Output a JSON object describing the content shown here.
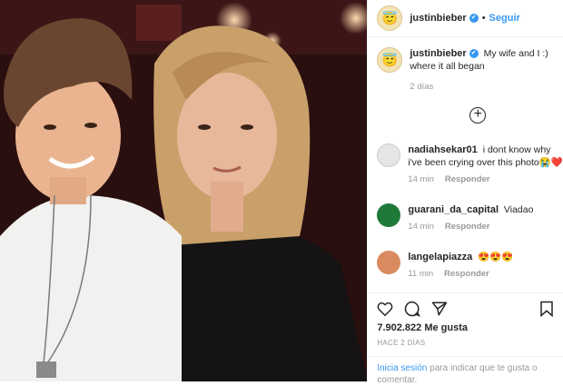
{
  "post": {
    "username": "justinbieber",
    "follow_label": "Seguir",
    "caption": "My wife and I :) where it all began",
    "caption_time": "2 días",
    "likes": "7.902.822 Me gusta",
    "posted_ago": "HACE 2 DÍAS",
    "login_link": "Inicia sesión",
    "login_rest": "para indicar que te gusta o comentar."
  },
  "comments": [
    {
      "user": "nadiahsekar01",
      "text": "i dont know why i've been crying over this photo😭❤️",
      "time": "14 min",
      "reply": "Responder"
    },
    {
      "user": "guarani_da_capital",
      "text": "Viadao",
      "time": "14 min",
      "reply": "Responder"
    },
    {
      "user": "langelapiazza",
      "text": "😍😍😍",
      "time": "11 min",
      "reply": "Responder"
    }
  ],
  "icons": [
    "heart-icon",
    "comment-icon",
    "share-icon",
    "bookmark-icon",
    "add-comment-icon",
    "verified-badge-icon"
  ],
  "colors": {
    "accent": "#3897f0",
    "text": "#262626",
    "muted": "#999999"
  }
}
